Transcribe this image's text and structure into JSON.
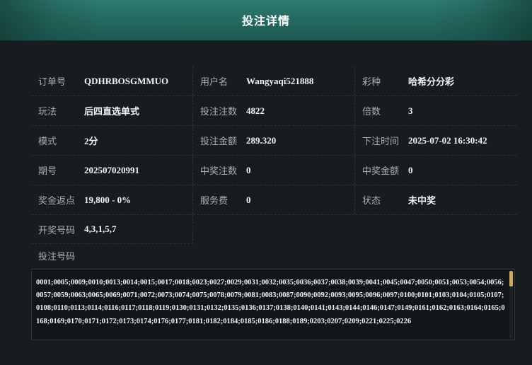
{
  "header": {
    "title": "投注详情"
  },
  "details": {
    "row1": {
      "order_label": "订单号",
      "order_value": "QDHRBOSGMMUO",
      "user_label": "用户名",
      "user_value": "Wangyaqi521888",
      "lottery_label": "彩种",
      "lottery_value": "哈希分分彩"
    },
    "row2": {
      "play_label": "玩法",
      "play_value": "后四直选单式",
      "bets_label": "投注注数",
      "bets_value": "4822",
      "multiple_label": "倍数",
      "multiple_value": "3"
    },
    "row3": {
      "mode_label": "模式",
      "mode_value": "2分",
      "amount_label": "投注金额",
      "amount_value": "289.320",
      "time_label": "下注时间",
      "time_value": "2025-07-02 16:30:42"
    },
    "row4": {
      "issue_label": "期号",
      "issue_value": "202507020991",
      "win_count_label": "中奖注数",
      "win_count_value": "0",
      "win_amount_label": "中奖金额",
      "win_amount_value": "0"
    },
    "row5": {
      "rebate_label": "奖金返点",
      "rebate_value": "19,800 - 0%",
      "fee_label": "服务费",
      "fee_value": "0",
      "status_label": "状态",
      "status_value": "未中奖"
    },
    "row6": {
      "draw_label": "开奖号码",
      "draw_value": "4,3,1,5,7"
    }
  },
  "bet_numbers": {
    "label": "投注号码",
    "text": "0001;0005;0009;0010;0013;0014;0015;0017;0018;0023;0027;0029;0031;0032;0035;0036;0037;0038;0039;0041;0045;0047;0050;0051;0053;0054;0056;0057;0059;0063;0065;0069;0071;0072;0073;0074;0075;0078;0079;0081;0083;0087;0090;0092;0093;0095;0096;0097;0100;0101;0103;0104;0105;0107;0108;0110;0113;0114;0116;0117;0118;0119;0130;0131;0132;0135;0136;0137;0138;0140;0141;0143;0144;0146;0147;0149;0161;0162;0163;0164;0165;0168;0169;0170;0171;0172;0173;0174;0176;0177;0181;0182;0184;0185;0186;0188;0189;0203;0207;0209;0221;0225;0226"
  },
  "colors": {
    "header_bg": "#2a7268",
    "accent_scroll": "#c9a86b",
    "panel_bg": "#171d1f"
  }
}
